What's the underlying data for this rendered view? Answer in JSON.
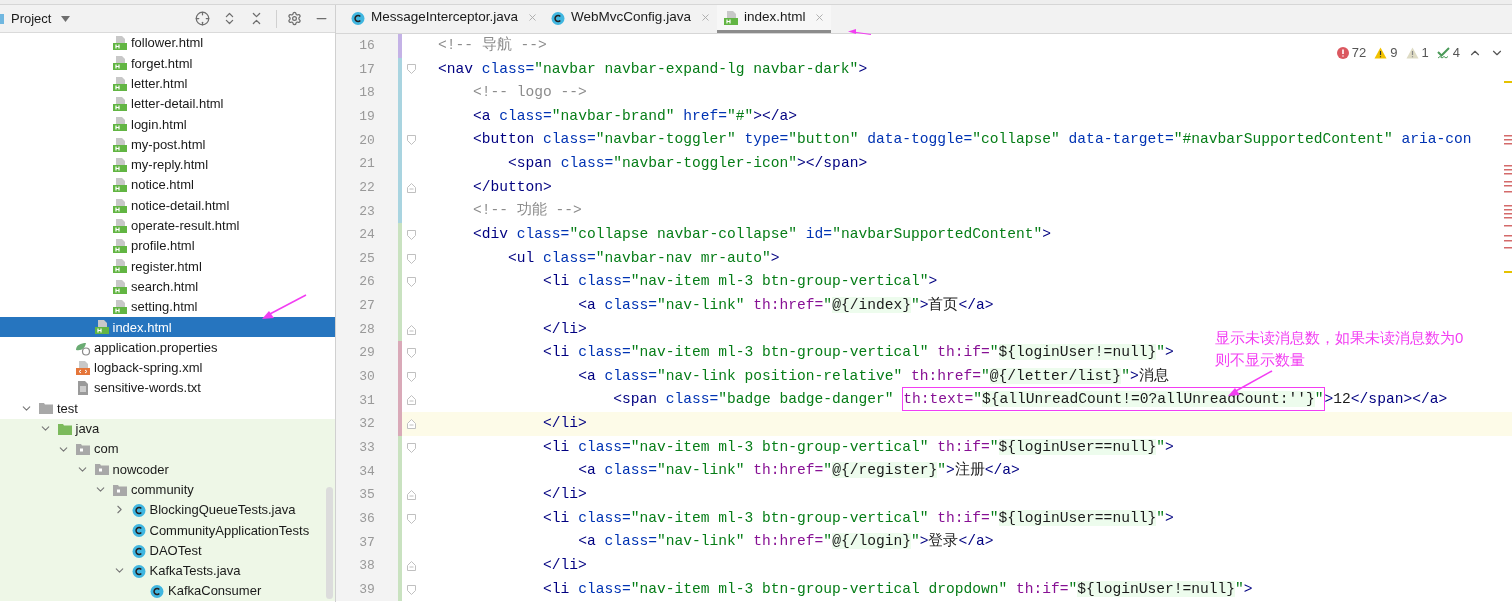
{
  "project_panel": {
    "title": "Project"
  },
  "tree": [
    {
      "children": [
        {
          "children": [
            {
              "children": [
                {
                  "children": [
                    {
                      "label": "follower.html",
                      "kind": "html",
                      "selected": false
                    },
                    {
                      "label": "forget.html",
                      "kind": "html",
                      "selected": false
                    },
                    {
                      "label": "letter.html",
                      "kind": "html",
                      "selected": false
                    },
                    {
                      "label": "letter-detail.html",
                      "kind": "html",
                      "selected": false
                    },
                    {
                      "label": "login.html",
                      "kind": "html",
                      "selected": false
                    },
                    {
                      "label": "my-post.html",
                      "kind": "html",
                      "selected": false
                    },
                    {
                      "label": "my-reply.html",
                      "kind": "html",
                      "selected": false
                    },
                    {
                      "label": "notice.html",
                      "kind": "html",
                      "selected": false
                    },
                    {
                      "label": "notice-detail.html",
                      "kind": "html",
                      "selected": false
                    },
                    {
                      "label": "operate-result.html",
                      "kind": "html",
                      "selected": false
                    },
                    {
                      "label": "profile.html",
                      "kind": "html",
                      "selected": false
                    },
                    {
                      "label": "register.html",
                      "kind": "html",
                      "selected": false
                    },
                    {
                      "label": "search.html",
                      "kind": "html",
                      "selected": false
                    },
                    {
                      "label": "setting.html",
                      "kind": "html",
                      "selected": false
                    }
                  ]
                },
                {
                  "label": "index.html",
                  "kind": "html",
                  "selected": true
                }
              ]
            },
            {
              "label": "application.properties",
              "kind": "properties",
              "selected": false
            },
            {
              "label": "logback-spring.xml",
              "kind": "xml",
              "selected": false
            },
            {
              "label": "sensitive-words.txt",
              "kind": "text",
              "selected": false
            }
          ]
        }
      ]
    },
    {
      "label": "test",
      "kind": "test-root",
      "selected": false,
      "expanded": true,
      "children": [
        {
          "label": "java",
          "kind": "source-folder",
          "selected": false,
          "expanded": true,
          "children": [
            {
              "label": "com",
              "kind": "package",
              "selected": false,
              "expanded": true,
              "children": [
                {
                  "label": "nowcoder",
                  "kind": "package",
                  "selected": false,
                  "expanded": true,
                  "children": [
                    {
                      "label": "community",
                      "kind": "package",
                      "selected": false,
                      "expanded": true,
                      "children": [
                        {
                          "label": "BlockingQueueTests.java",
                          "kind": "class",
                          "selected": false,
                          "expanded": false
                        },
                        {
                          "label": "CommunityApplicationTests",
                          "kind": "class",
                          "selected": false
                        },
                        {
                          "label": "DAOTest",
                          "kind": "class",
                          "selected": false
                        },
                        {
                          "label": "KafkaTests.java",
                          "kind": "class",
                          "selected": false,
                          "expanded": true,
                          "children": [
                            {
                              "label": "KafkaConsumer",
                              "kind": "class",
                              "selected": false
                            }
                          ]
                        }
                      ]
                    }
                  ]
                }
              ]
            }
          ]
        }
      ]
    }
  ],
  "tabs": [
    {
      "label": "MessageInterceptor.java",
      "kind": "class",
      "selected": false
    },
    {
      "label": "WebMvcConfig.java",
      "kind": "class",
      "selected": false
    },
    {
      "label": "index.html",
      "kind": "html",
      "selected": true
    }
  ],
  "inspections": [
    {
      "kind": "error",
      "count": "72"
    },
    {
      "kind": "warning",
      "count": "9"
    },
    {
      "kind": "weak",
      "count": "1"
    },
    {
      "kind": "typo",
      "count": "4"
    }
  ],
  "lines": [
    {
      "number": "16",
      "color": "#c4b2e6",
      "current": false,
      "kind": "plain",
      "segments": [
        {
          "text": "<!-- 导航 -->",
          "boxed": false
        }
      ]
    },
    {
      "number": "17",
      "color": "#a9d4e0",
      "current": false,
      "kind": "fold-start",
      "segments": [
        {
          "text": "<nav class=\"navbar navbar-expand-lg navbar-dark\">",
          "boxed": false
        }
      ]
    },
    {
      "number": "18",
      "color": "#a9d4e0",
      "current": false,
      "kind": "plain",
      "segments": [
        {
          "text": "    <!-- logo -->",
          "boxed": false
        }
      ]
    },
    {
      "number": "19",
      "color": "#a9d4e0",
      "current": false,
      "kind": "plain",
      "segments": [
        {
          "text": "    <a class=\"navbar-brand\" href=\"#\"></a>",
          "boxed": false
        }
      ]
    },
    {
      "number": "20",
      "color": "#a9d4e0",
      "current": false,
      "kind": "fold-start",
      "segments": [
        {
          "text": "    <button class=\"navbar-toggler\" type=\"button\" data-toggle=\"collapse\" data-target=\"#navbarSupportedContent\" aria-con",
          "boxed": false
        }
      ]
    },
    {
      "number": "21",
      "color": "#a9d4e0",
      "current": false,
      "kind": "plain",
      "segments": [
        {
          "text": "        <span class=\"navbar-toggler-icon\"></span>",
          "boxed": false
        }
      ]
    },
    {
      "number": "22",
      "color": "#a9d4e0",
      "current": false,
      "kind": "fold-end",
      "segments": [
        {
          "text": "    </button>",
          "boxed": false
        }
      ]
    },
    {
      "number": "23",
      "color": "#a9d4e0",
      "current": false,
      "kind": "plain",
      "segments": [
        {
          "text": "    <!-- 功能 -->",
          "boxed": false
        }
      ]
    },
    {
      "number": "24",
      "color": "#c9e2c0",
      "current": false,
      "kind": "fold-start",
      "segments": [
        {
          "text": "    <div class=\"collapse navbar-collapse\" id=\"navbarSupportedContent\">",
          "boxed": false
        }
      ]
    },
    {
      "number": "25",
      "color": "#c9e2c0",
      "current": false,
      "kind": "fold-start",
      "segments": [
        {
          "text": "        <ul class=\"navbar-nav mr-auto\">",
          "boxed": false
        }
      ]
    },
    {
      "number": "26",
      "color": "#c9e2c0",
      "current": false,
      "kind": "fold-start",
      "segments": [
        {
          "text": "            <li class=\"nav-item ml-3 btn-group-vertical\">",
          "boxed": false
        }
      ]
    },
    {
      "number": "27",
      "color": "#c9e2c0",
      "current": false,
      "kind": "plain",
      "segments": [
        {
          "text": "                <a class=\"nav-link\" th:href=\"@{/index}\">首页</a>",
          "boxed": false
        }
      ]
    },
    {
      "number": "28",
      "color": "#c9e2c0",
      "current": false,
      "kind": "fold-end",
      "segments": [
        {
          "text": "            </li>",
          "boxed": false
        }
      ]
    },
    {
      "number": "29",
      "color": "#d9a9b8",
      "current": false,
      "kind": "fold-start",
      "segments": [
        {
          "text": "            <li class=\"nav-item ml-3 btn-group-vertical\" th:if=\"${loginUser!=null}\">",
          "boxed": false
        }
      ]
    },
    {
      "number": "30",
      "color": "#d9a9b8",
      "current": false,
      "kind": "fold-start",
      "segments": [
        {
          "text": "                <a class=\"nav-link position-relative\" th:href=\"@{/letter/list}\">消息",
          "boxed": false
        }
      ]
    },
    {
      "number": "31",
      "color": "#d9a9b8",
      "current": false,
      "kind": "fold-end",
      "segments": [
        {
          "text": "                    <span class=\"badge badge-danger\" ",
          "boxed": false
        },
        {
          "text": "th:text=\"${allUnreadCount!=0?allUnreadCount:''}\"",
          "boxed": true
        },
        {
          "text": ">12</span></a>",
          "boxed": false
        }
      ]
    },
    {
      "number": "32",
      "color": "#d9a9b8",
      "current": true,
      "kind": "fold-end",
      "segments": [
        {
          "text": "            </li>",
          "boxed": false
        }
      ]
    },
    {
      "number": "33",
      "color": "#c9e2c0",
      "current": false,
      "kind": "fold-start",
      "segments": [
        {
          "text": "            <li class=\"nav-item ml-3 btn-group-vertical\" th:if=\"${loginUser==null}\">",
          "boxed": false
        }
      ]
    },
    {
      "number": "34",
      "color": "#c9e2c0",
      "current": false,
      "kind": "plain",
      "segments": [
        {
          "text": "                <a class=\"nav-link\" th:href=\"@{/register}\">注册</a>",
          "boxed": false
        }
      ]
    },
    {
      "number": "35",
      "color": "#c9e2c0",
      "current": false,
      "kind": "fold-end",
      "segments": [
        {
          "text": "            </li>",
          "boxed": false
        }
      ]
    },
    {
      "number": "36",
      "color": "#c9e2c0",
      "current": false,
      "kind": "fold-start",
      "segments": [
        {
          "text": "            <li class=\"nav-item ml-3 btn-group-vertical\" th:if=\"${loginUser==null}\">",
          "boxed": false
        }
      ]
    },
    {
      "number": "37",
      "color": "#c9e2c0",
      "current": false,
      "kind": "plain",
      "segments": [
        {
          "text": "                <a class=\"nav-link\" th:href=\"@{/login}\">登录</a>",
          "boxed": false
        }
      ]
    },
    {
      "number": "38",
      "color": "#c9e2c0",
      "current": false,
      "kind": "fold-end",
      "segments": [
        {
          "text": "            </li>",
          "boxed": false
        }
      ]
    },
    {
      "number": "39",
      "color": "#c9e2c0",
      "current": false,
      "kind": "fold-start",
      "segments": [
        {
          "text": "            <li class=\"nav-item ml-3 btn-group-vertical dropdown\" th:if=\"${loginUser!=null}\">",
          "boxed": false
        }
      ]
    }
  ],
  "annotation": {
    "lines": [
      "显示未读消息数，如果未读消息数为0",
      "则不显示数量"
    ]
  }
}
